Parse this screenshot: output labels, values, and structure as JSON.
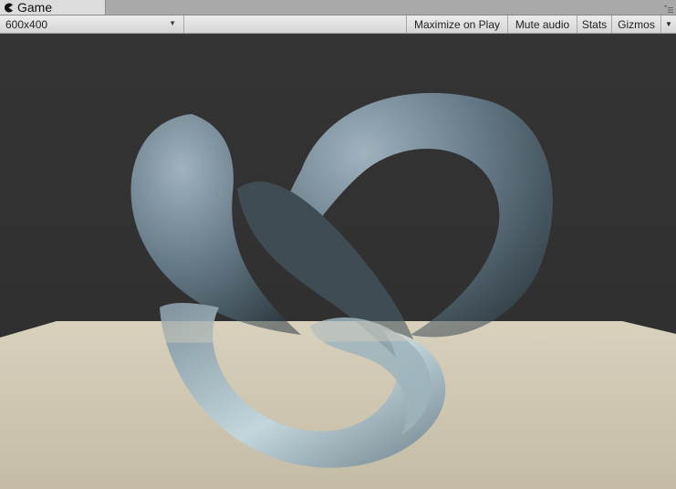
{
  "window": {
    "tab_label": "Game",
    "tab_icon": "pacman-game-icon",
    "menu_icon": "tab-menu-icon"
  },
  "toolbar": {
    "resolution_value": "600x400",
    "maximize_label": "Maximize on Play",
    "mute_label": "Mute audio",
    "stats_label": "Stats",
    "gizmos_label": "Gizmos"
  },
  "scene": {
    "sky_color": "#333333",
    "floor_color": "#cfc7b2",
    "torus_color": "#5f7481",
    "torus_highlight": "#b9d0d8",
    "object": "torus-knot"
  }
}
